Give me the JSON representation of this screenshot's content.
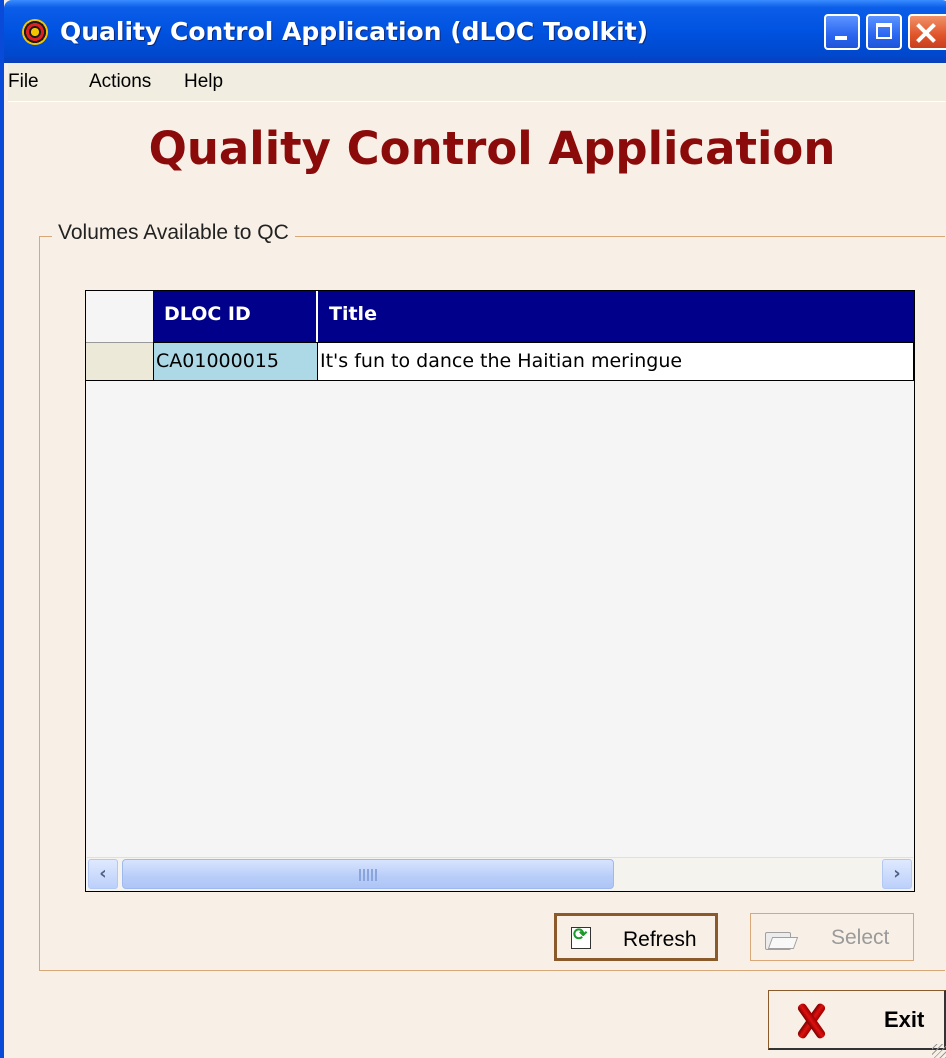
{
  "window": {
    "title": "Quality Control Application (dLOC Toolkit)",
    "icons": {
      "app": "target-icon",
      "minimize": "minimize-icon",
      "maximize": "maximize-icon",
      "close": "close-icon"
    }
  },
  "menu": {
    "file": "File",
    "actions": "Actions",
    "help": "Help"
  },
  "heading": "Quality Control Application",
  "group": {
    "label": "Volumes Available to QC"
  },
  "grid": {
    "columns": [
      "DLOC ID",
      "Title"
    ],
    "rows": [
      {
        "dloc_id": "CA01000015",
        "title": "It's fun to dance the Haitian meringue"
      }
    ]
  },
  "buttons": {
    "refresh": "Refresh",
    "select": "Select",
    "exit": "Exit"
  },
  "colors": {
    "heading": "#8b0a0a",
    "grid_header": "#00008b",
    "selected_cell": "#add8e6",
    "background": "#f8f0e6"
  }
}
